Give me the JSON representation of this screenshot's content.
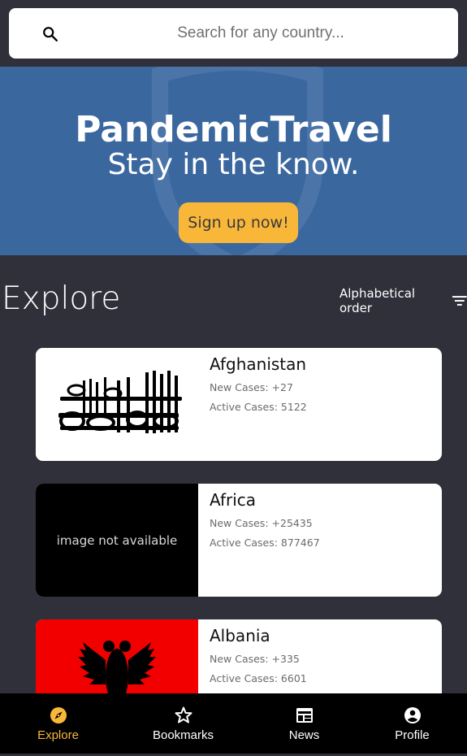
{
  "search": {
    "placeholder": "Search for any country..."
  },
  "banner": {
    "title": "PandemicTravel",
    "subtitle": "Stay in the know.",
    "cta_label": "Sign up now!"
  },
  "explore": {
    "title": "Explore",
    "sort_label": "Alphabetical order"
  },
  "countries": [
    {
      "name": "Afghanistan",
      "new_cases": "New Cases: +27",
      "active_cases": "Active Cases: 5122",
      "flag": "afghanistan-flag"
    },
    {
      "name": "Africa",
      "new_cases": "New Cases: +25435",
      "active_cases": "Active Cases: 877467",
      "flag_text": "image not available"
    },
    {
      "name": "Albania",
      "new_cases": "New Cases: +335",
      "active_cases": "Active Cases: 6601",
      "flag": "albania-flag"
    }
  ],
  "nav": {
    "items": [
      {
        "label": "Explore",
        "icon": "compass-icon",
        "active": true
      },
      {
        "label": "Bookmarks",
        "icon": "star-icon"
      },
      {
        "label": "News",
        "icon": "newspaper-icon"
      },
      {
        "label": "Profile",
        "icon": "account-circle-icon"
      }
    ]
  },
  "colors": {
    "accent": "#f9b73a",
    "banner": "#3b679f",
    "background": "#2f3039"
  }
}
